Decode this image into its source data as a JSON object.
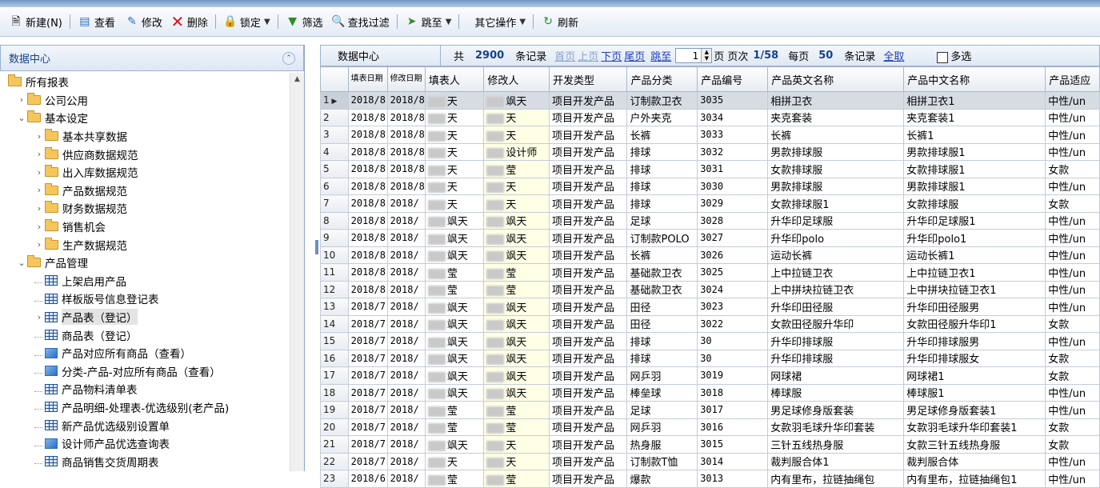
{
  "toolbar": {
    "new": "新建(N)",
    "view": "查看",
    "edit": "修改",
    "delete": "删除",
    "lock": "锁定",
    "filter": "筛选",
    "search_filter": "查找过滤",
    "goto": "跳至",
    "other": "其它操作",
    "refresh": "刷新"
  },
  "sidebar": {
    "title": "数据中心",
    "items": [
      {
        "label": "所有报表",
        "level": 0,
        "type": "folder",
        "arrow": ""
      },
      {
        "label": "公司公用",
        "level": 1,
        "type": "folder",
        "arrow": "›"
      },
      {
        "label": "基本设定",
        "level": 1,
        "type": "folder",
        "arrow": "⌄"
      },
      {
        "label": "基本共享数据",
        "level": 2,
        "type": "folder",
        "arrow": "›"
      },
      {
        "label": "供应商数据规范",
        "level": 2,
        "type": "folder",
        "arrow": "›"
      },
      {
        "label": "出入库数据规范",
        "level": 2,
        "type": "folder",
        "arrow": "›"
      },
      {
        "label": "产品数据规范",
        "level": 2,
        "type": "folder",
        "arrow": "›"
      },
      {
        "label": "财务数据规范",
        "level": 2,
        "type": "folder",
        "arrow": "›"
      },
      {
        "label": "销售机会",
        "level": 2,
        "type": "folder",
        "arrow": "›"
      },
      {
        "label": "生产数据规范",
        "level": 2,
        "type": "folder",
        "arrow": "›"
      },
      {
        "label": "产品管理",
        "level": 1,
        "type": "folder",
        "arrow": "⌄"
      },
      {
        "label": "上架启用产品",
        "level": 2,
        "type": "grid",
        "arrow": ""
      },
      {
        "label": "样板版号信息登记表",
        "level": 2,
        "type": "grid",
        "arrow": ""
      },
      {
        "label": "产品表（登记）",
        "level": 2,
        "type": "grid",
        "arrow": "›",
        "selected": true
      },
      {
        "label": "商品表（登记）",
        "level": 2,
        "type": "grid",
        "arrow": ""
      },
      {
        "label": "产品对应所有商品（查看）",
        "level": 2,
        "type": "view",
        "arrow": ""
      },
      {
        "label": "分类-产品-对应所有商品（查看）",
        "level": 2,
        "type": "view",
        "arrow": ""
      },
      {
        "label": "产品物料清单表",
        "level": 2,
        "type": "grid",
        "arrow": ""
      },
      {
        "label": "产品明细-处理表-优选级别(老产品)",
        "level": 2,
        "type": "grid",
        "arrow": ""
      },
      {
        "label": "新产品优选级别设置单",
        "level": 2,
        "type": "grid",
        "arrow": ""
      },
      {
        "label": "设计师产品优选查询表",
        "level": 2,
        "type": "view",
        "arrow": ""
      },
      {
        "label": "商品销售交货周期表",
        "level": 2,
        "type": "grid",
        "arrow": ""
      }
    ]
  },
  "pager": {
    "title": "数据中心",
    "total_prefix": "共",
    "total": "2900",
    "records_label": "条记录",
    "first": "首页",
    "prev": "上页",
    "next": "下页",
    "last": "尾页",
    "jump": "跳至",
    "page_input": "1",
    "page_unit": "页",
    "page_index_label": "页次",
    "page_index": "1/58",
    "per_page_label": "每页",
    "per_page": "50",
    "per_page_suffix": "条记录",
    "select_all": "全取",
    "multi": "多选"
  },
  "table": {
    "columns": [
      "",
      "填表日期",
      "修改日期",
      "填表人",
      "修改人",
      "开发类型",
      "产品分类",
      "产品编号",
      "产品英文名称",
      "产品中文名称",
      "产品适应"
    ],
    "rows": [
      [
        "1",
        "2018/8",
        "2018/8",
        "天",
        "飒天",
        "项目开发产品",
        "订制款卫衣",
        "3035",
        "相拼卫衣",
        "相拼卫衣1",
        "中性/un"
      ],
      [
        "2",
        "2018/8",
        "2018/8",
        "天",
        "天",
        "项目开发产品",
        "户外夹克",
        "3034",
        "夹克套装",
        "夹克套装1",
        "中性/un"
      ],
      [
        "3",
        "2018/8",
        "2018/8",
        "天",
        "天",
        "项目开发产品",
        "长裤",
        "3033",
        "长裤",
        "长裤1",
        "中性/un"
      ],
      [
        "4",
        "2018/8",
        "2018/8",
        "天",
        "设计师",
        "项目开发产品",
        "排球",
        "3032",
        "男款排球服",
        "男款排球服1",
        "中性/un"
      ],
      [
        "5",
        "2018/8",
        "2018/8",
        "天",
        "莹",
        "项目开发产品",
        "排球",
        "3031",
        "女款排球服",
        "女款排球服1",
        "女款"
      ],
      [
        "6",
        "2018/8",
        "2018/8",
        "天",
        "天",
        "项目开发产品",
        "排球",
        "3030",
        "男款排球服",
        "男款排球服1",
        "中性/un"
      ],
      [
        "7",
        "2018/8",
        "2018/",
        "天",
        "天",
        "项目开发产品",
        "排球",
        "3029",
        "女款排球服1",
        "女款排球服",
        "女款"
      ],
      [
        "8",
        "2018/8",
        "2018/",
        "飒天",
        "飒天",
        "项目开发产品",
        "足球",
        "3028",
        "升华印足球服",
        "升华印足球服1",
        "中性/un"
      ],
      [
        "9",
        "2018/8",
        "2018/",
        "飒天",
        "飒天",
        "项目开发产品",
        "订制款POLO",
        "3027",
        "升华印polo",
        "升华印polo1",
        "中性/un"
      ],
      [
        "10",
        "2018/8",
        "2018/",
        "飒天",
        "飒天",
        "项目开发产品",
        "长裤",
        "3026",
        "运动长裤",
        "运动长裤1",
        "中性/un"
      ],
      [
        "11",
        "2018/8",
        "2018/",
        "莹",
        "莹",
        "项目开发产品",
        "基础款卫衣",
        "3025",
        "上中拉链卫衣",
        "上中拉链卫衣1",
        "中性/un"
      ],
      [
        "12",
        "2018/8",
        "2018/",
        "莹",
        "莹",
        "项目开发产品",
        "基础款卫衣",
        "3024",
        " 上中拼块拉链卫衣",
        " 上中拼块拉链卫衣1",
        "中性/un"
      ],
      [
        "13",
        "2018/7",
        "2018/",
        "飒天",
        "飒天",
        "项目开发产品",
        "田径",
        "3023",
        "升华印田径服",
        "升华印田径服男",
        "中性/un"
      ],
      [
        "14",
        "2018/7",
        "2018/",
        "飒天",
        "飒天",
        "项目开发产品",
        "田径",
        "3022",
        "女款田径服升华印",
        "女款田径服升华印1",
        "女款"
      ],
      [
        "15",
        "2018/7",
        "2018/",
        "飒天",
        "飒天",
        "项目开发产品",
        "排球",
        "30",
        "升华印排球服",
        "升华印排球服男",
        "中性/un"
      ],
      [
        "16",
        "2018/7",
        "2018/",
        "飒天",
        "飒天",
        "项目开发产品",
        "排球",
        "30",
        "升华印排球服",
        "升华印排球服女",
        "女款"
      ],
      [
        "17",
        "2018/7",
        "2018/",
        "飒天",
        "飒天",
        "项目开发产品",
        "网乒羽",
        "3019",
        "网球裙",
        "网球裙1",
        "女款"
      ],
      [
        "18",
        "2018/7",
        "2018/",
        "飒天",
        "飒天",
        "项目开发产品",
        "棒垒球",
        "3018",
        "棒球服",
        "棒球服1",
        "中性/un"
      ],
      [
        "19",
        "2018/7",
        "2018/",
        "莹",
        "莹",
        "项目开发产品",
        "足球",
        "3017",
        "男足球修身版套装",
        "男足球修身版套装1",
        "中性/un"
      ],
      [
        "20",
        "2018/7",
        "2018/",
        "莹",
        "莹",
        "项目开发产品",
        "网乒羽",
        "3016",
        "女款羽毛球升华印套装",
        "女款羽毛球升华印套装1",
        "女款"
      ],
      [
        "21",
        "2018/7",
        "2018/",
        "飒天",
        "天",
        "项目开发产品",
        "热身服",
        "3015",
        "三针五线热身服",
        "女款三针五线热身服",
        "女款"
      ],
      [
        "22",
        "2018/7",
        "2018/",
        "天",
        "天",
        "项目开发产品",
        "订制款T恤",
        "3014",
        "裁判服合体1",
        "裁判服合体",
        "中性/un"
      ],
      [
        "23",
        "2018/6",
        "2018/",
        "莹",
        "莹",
        "项目开发产品",
        "爆款",
        "3013",
        "内有里布，拉链抽绳包",
        "内有里布，拉链抽绳包1",
        "中性/un"
      ]
    ]
  },
  "colors": {
    "accent": "#15428b",
    "link": "#1c3fbd",
    "modifier_column_bg": "#ffffe6"
  }
}
